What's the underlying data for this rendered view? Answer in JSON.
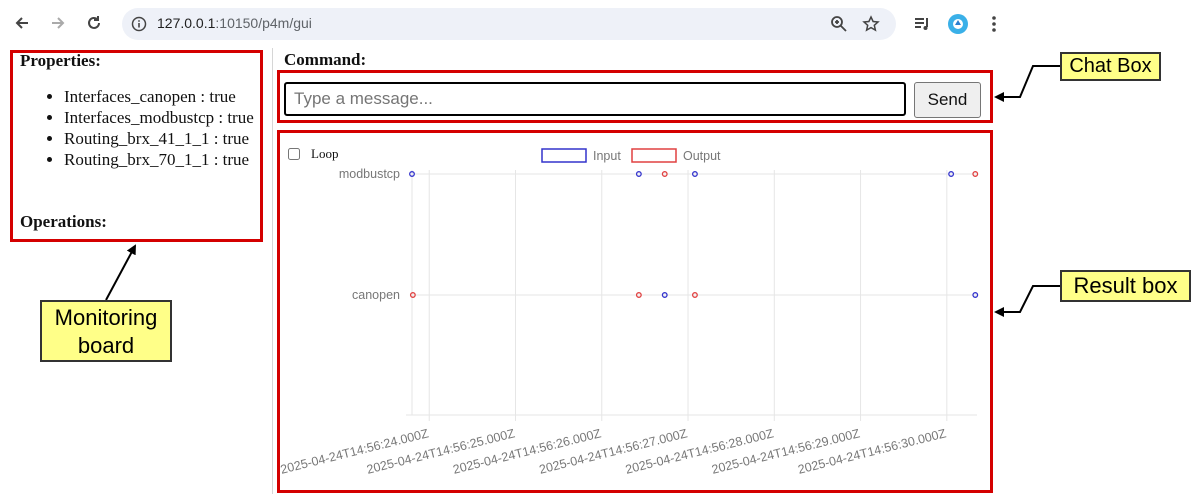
{
  "browser": {
    "url_host": "127.0.0.1",
    "url_rest": ":10150/p4m/gui"
  },
  "left_panel": {
    "properties_heading": "Properties:",
    "properties": [
      "Interfaces_canopen : true",
      "Interfaces_modbustcp : true",
      "Routing_brx_41_1_1 : true",
      "Routing_brx_70_1_1 : true"
    ],
    "operations_heading": "Operations:"
  },
  "command": {
    "heading": "Command:",
    "placeholder": "Type a message...",
    "send_label": "Send"
  },
  "result": {
    "loop_label": "Loop",
    "loop_checked": false
  },
  "chart_data": {
    "type": "scatter",
    "y_categories": [
      "modbustcp",
      "canopen"
    ],
    "x_ticks": [
      "2025-04-24T14:56:24.000Z",
      "2025-04-24T14:56:25.000Z",
      "2025-04-24T14:56:26.000Z",
      "2025-04-24T14:56:27.000Z",
      "2025-04-24T14:56:28.000Z",
      "2025-04-24T14:56:29.000Z",
      "2025-04-24T14:56:30.000Z"
    ],
    "xlim": [
      23.8,
      30.35
    ],
    "series": [
      {
        "name": "Input",
        "color": "#3333cc",
        "points": [
          {
            "t": 23.8,
            "y": "modbustcp"
          },
          {
            "t": 26.43,
            "y": "modbustcp"
          },
          {
            "t": 27.08,
            "y": "modbustcp"
          },
          {
            "t": 30.05,
            "y": "modbustcp"
          },
          {
            "t": 26.73,
            "y": "canopen"
          },
          {
            "t": 30.33,
            "y": "canopen"
          }
        ]
      },
      {
        "name": "Output",
        "color": "#e04040",
        "points": [
          {
            "t": 26.73,
            "y": "modbustcp"
          },
          {
            "t": 30.33,
            "y": "modbustcp"
          },
          {
            "t": 23.81,
            "y": "canopen"
          },
          {
            "t": 26.43,
            "y": "canopen"
          },
          {
            "t": 27.08,
            "y": "canopen"
          }
        ]
      }
    ],
    "grid": true,
    "legend": "top-center"
  },
  "annotations": {
    "chat_box": "Chat Box",
    "result_box": "Result box",
    "monitoring_board": "Monitoring board",
    "box_color": "#d40000",
    "callout_color": "#ffff88"
  }
}
